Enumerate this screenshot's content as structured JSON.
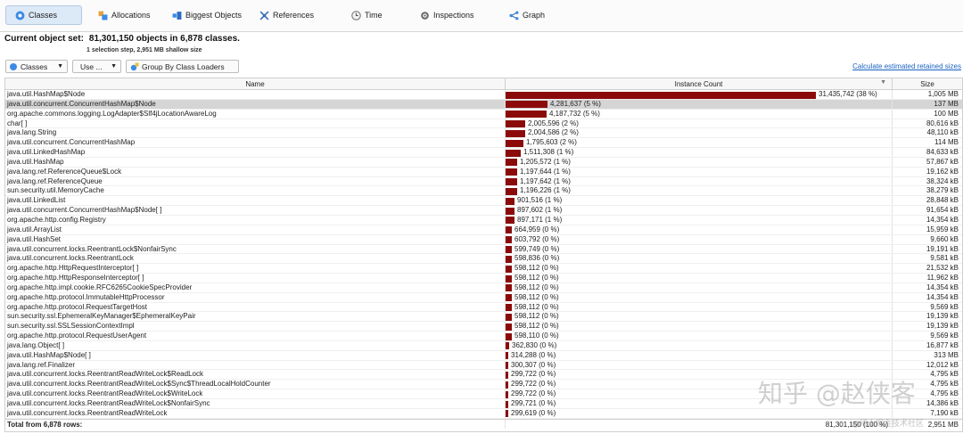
{
  "toolbar": {
    "items": [
      {
        "label": "Classes",
        "icon": "classes-icon"
      },
      {
        "label": "Allocations",
        "icon": "allocations-icon"
      },
      {
        "label": "Biggest Objects",
        "icon": "biggest-objects-icon"
      },
      {
        "label": "References",
        "icon": "references-icon"
      },
      {
        "label": "Time",
        "icon": "time-icon"
      },
      {
        "label": "Inspections",
        "icon": "inspections-icon"
      },
      {
        "label": "Graph",
        "icon": "graph-icon"
      }
    ]
  },
  "summary": {
    "label": "Current object set:",
    "value": "81,301,150 objects in 6,878 classes.",
    "sub": "1 selection step, 2,951 MB shallow size"
  },
  "controls": {
    "view_select": "Classes",
    "use_button": "Use ...",
    "group_button": "Group By Class Loaders",
    "calc_link": "Calculate estimated retained sizes"
  },
  "table": {
    "columns": {
      "name": "Name",
      "count": "Instance Count",
      "size": "Size"
    },
    "max_count": 31435742,
    "rows": [
      {
        "name": "java.util.HashMap$Node",
        "count": 31435742,
        "count_label": "31,435,742 (38 %)",
        "size": "1,005 MB"
      },
      {
        "name": "java.util.concurrent.ConcurrentHashMap$Node",
        "count": 4281637,
        "count_label": "4,281,637 (5 %)",
        "size": "137 MB",
        "selected": true
      },
      {
        "name": "org.apache.commons.logging.LogAdapter$Slf4jLocationAwareLog",
        "count": 4187732,
        "count_label": "4,187,732 (5 %)",
        "size": "100 MB"
      },
      {
        "name": "char[ ]",
        "count": 2005596,
        "count_label": "2,005,596 (2 %)",
        "size": "80,616 kB"
      },
      {
        "name": "java.lang.String",
        "count": 2004586,
        "count_label": "2,004,586 (2 %)",
        "size": "48,110 kB"
      },
      {
        "name": "java.util.concurrent.ConcurrentHashMap",
        "count": 1795603,
        "count_label": "1,795,603 (2 %)",
        "size": "114 MB"
      },
      {
        "name": "java.util.LinkedHashMap",
        "count": 1511308,
        "count_label": "1,511,308 (1 %)",
        "size": "84,633 kB"
      },
      {
        "name": "java.util.HashMap",
        "count": 1205572,
        "count_label": "1,205,572 (1 %)",
        "size": "57,867 kB"
      },
      {
        "name": "java.lang.ref.ReferenceQueue$Lock",
        "count": 1197644,
        "count_label": "1,197,644 (1 %)",
        "size": "19,162 kB"
      },
      {
        "name": "java.lang.ref.ReferenceQueue",
        "count": 1197642,
        "count_label": "1,197,642 (1 %)",
        "size": "38,324 kB"
      },
      {
        "name": "sun.security.util.MemoryCache",
        "count": 1196226,
        "count_label": "1,196,226 (1 %)",
        "size": "38,279 kB"
      },
      {
        "name": "java.util.LinkedList",
        "count": 901516,
        "count_label": "901,516 (1 %)",
        "size": "28,848 kB"
      },
      {
        "name": "java.util.concurrent.ConcurrentHashMap$Node[ ]",
        "count": 897602,
        "count_label": "897,602 (1 %)",
        "size": "91,654 kB"
      },
      {
        "name": "org.apache.http.config.Registry",
        "count": 897171,
        "count_label": "897,171 (1 %)",
        "size": "14,354 kB"
      },
      {
        "name": "java.util.ArrayList",
        "count": 664959,
        "count_label": "664,959 (0 %)",
        "size": "15,959 kB"
      },
      {
        "name": "java.util.HashSet",
        "count": 603792,
        "count_label": "603,792 (0 %)",
        "size": "9,660 kB"
      },
      {
        "name": "java.util.concurrent.locks.ReentrantLock$NonfairSync",
        "count": 599749,
        "count_label": "599,749 (0 %)",
        "size": "19,191 kB"
      },
      {
        "name": "java.util.concurrent.locks.ReentrantLock",
        "count": 598836,
        "count_label": "598,836 (0 %)",
        "size": "9,581 kB"
      },
      {
        "name": "org.apache.http.HttpRequestInterceptor[ ]",
        "count": 598112,
        "count_label": "598,112 (0 %)",
        "size": "21,532 kB"
      },
      {
        "name": "org.apache.http.HttpResponseInterceptor[ ]",
        "count": 598112,
        "count_label": "598,112 (0 %)",
        "size": "11,962 kB"
      },
      {
        "name": "org.apache.http.impl.cookie.RFC6265CookieSpecProvider",
        "count": 598112,
        "count_label": "598,112 (0 %)",
        "size": "14,354 kB"
      },
      {
        "name": "org.apache.http.protocol.ImmutableHttpProcessor",
        "count": 598112,
        "count_label": "598,112 (0 %)",
        "size": "14,354 kB"
      },
      {
        "name": "org.apache.http.protocol.RequestTargetHost",
        "count": 598112,
        "count_label": "598,112 (0 %)",
        "size": "9,569 kB"
      },
      {
        "name": "sun.security.ssl.EphemeralKeyManager$EphemeralKeyPair",
        "count": 598112,
        "count_label": "598,112 (0 %)",
        "size": "19,139 kB"
      },
      {
        "name": "sun.security.ssl.SSLSessionContextImpl",
        "count": 598112,
        "count_label": "598,112 (0 %)",
        "size": "19,139 kB"
      },
      {
        "name": "org.apache.http.protocol.RequestUserAgent",
        "count": 598110,
        "count_label": "598,110 (0 %)",
        "size": "9,569 kB"
      },
      {
        "name": "java.lang.Object[ ]",
        "count": 362830,
        "count_label": "362,830 (0 %)",
        "size": "16,877 kB"
      },
      {
        "name": "java.util.HashMap$Node[ ]",
        "count": 314288,
        "count_label": "314,288 (0 %)",
        "size": "313 MB"
      },
      {
        "name": "java.lang.ref.Finalizer",
        "count": 300307,
        "count_label": "300,307 (0 %)",
        "size": "12,012 kB"
      },
      {
        "name": "java.util.concurrent.locks.ReentrantReadWriteLock$ReadLock",
        "count": 299722,
        "count_label": "299,722 (0 %)",
        "size": "4,795 kB"
      },
      {
        "name": "java.util.concurrent.locks.ReentrantReadWriteLock$Sync$ThreadLocalHoldCounter",
        "count": 299722,
        "count_label": "299,722 (0 %)",
        "size": "4,795 kB"
      },
      {
        "name": "java.util.concurrent.locks.ReentrantReadWriteLock$WriteLock",
        "count": 299722,
        "count_label": "299,722 (0 %)",
        "size": "4,795 kB"
      },
      {
        "name": "java.util.concurrent.locks.ReentrantReadWriteLock$NonfairSync",
        "count": 299721,
        "count_label": "299,721 (0 %)",
        "size": "14,386 kB"
      },
      {
        "name": "java.util.concurrent.locks.ReentrantReadWriteLock",
        "count": 299619,
        "count_label": "299,619 (0 %)",
        "size": "7,190 kB"
      }
    ],
    "footer": {
      "label": "Total from 6,878 rows:",
      "count": "81,301,150 (100 %)",
      "size": "2,951 MB"
    }
  },
  "watermark": {
    "main": "知乎 @赵侠客",
    "sub": "@稀土掘金技术社区"
  },
  "colors": {
    "bar": "#8b0b0b",
    "selected_row": "#d5d5d5",
    "link": "#1a62c4",
    "active_tab": "#dce9f7"
  }
}
